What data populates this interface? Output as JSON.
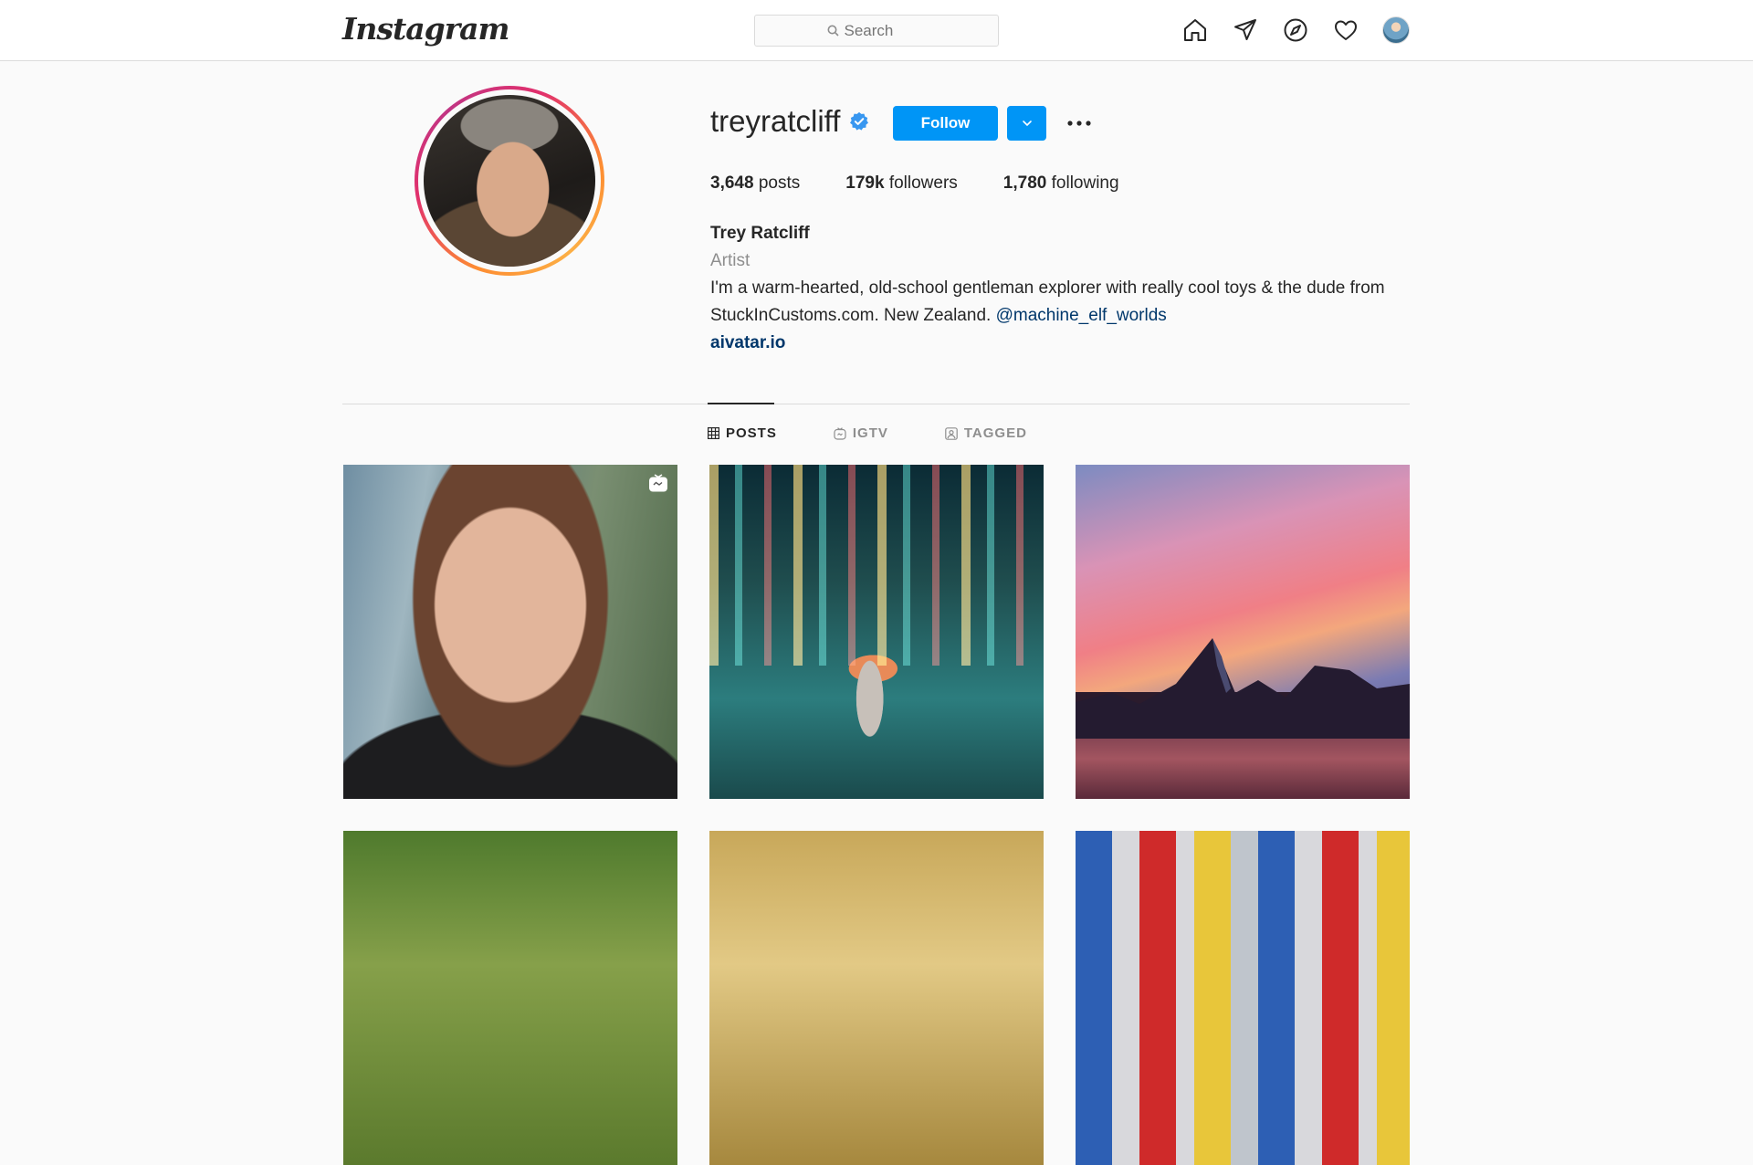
{
  "header": {
    "logo_text": "Instagram",
    "search_placeholder": "Search",
    "icons": [
      "home-icon",
      "direct-icon",
      "explore-icon",
      "activity-heart-icon",
      "profile-avatar"
    ]
  },
  "profile": {
    "username": "treyratcliff",
    "verified": true,
    "follow_label": "Follow",
    "stats": [
      {
        "value": "3,648",
        "label": "posts"
      },
      {
        "value": "179k",
        "label": "followers"
      },
      {
        "value": "1,780",
        "label": "following"
      }
    ],
    "bio": {
      "full_name": "Trey Ratcliff",
      "category": "Artist",
      "text": "I'm a warm-hearted, old-school gentleman explorer with really cool toys & the dude from StuckInCustoms.com. New Zealand. ",
      "mention": "@machine_elf_worlds",
      "link": "aivatar.io"
    }
  },
  "tabs": [
    {
      "label": "POSTS",
      "active": true,
      "icon": "grid-icon"
    },
    {
      "label": "IGTV",
      "active": false,
      "icon": "igtv-icon"
    },
    {
      "label": "TAGGED",
      "active": false,
      "icon": "tagged-icon"
    }
  ],
  "colors": {
    "accent": "#0095f6",
    "text": "#262626",
    "muted": "#8e8e8e",
    "link": "#00376b",
    "background": "#fafafa",
    "border": "#dbdbdb"
  }
}
